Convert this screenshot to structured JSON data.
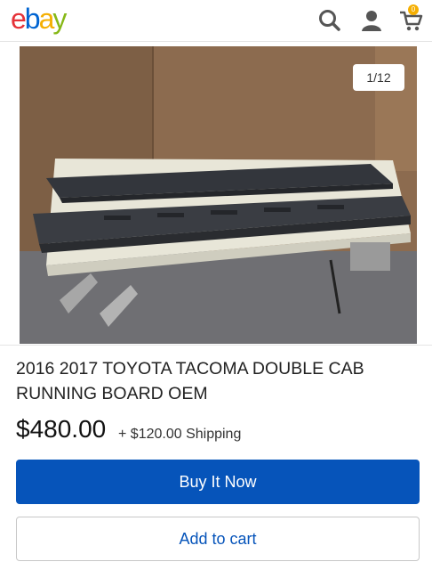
{
  "header": {
    "logo_letters": [
      {
        "char": "e",
        "color": "#e53238"
      },
      {
        "char": "b",
        "color": "#0064d2"
      },
      {
        "char": "a",
        "color": "#f5af02"
      },
      {
        "char": "y",
        "color": "#86b817"
      }
    ],
    "cart_count": "0",
    "icons": [
      "search-icon",
      "user-icon",
      "cart-icon"
    ]
  },
  "gallery": {
    "counter": "1/12"
  },
  "listing": {
    "title": "2016 2017 TOYOTA TACOMA DOUBLE CAB RUNNING BOARD OEM",
    "price": "$480.00",
    "shipping": "+ $120.00 Shipping"
  },
  "actions": {
    "buy_now_label": "Buy It Now",
    "add_to_cart_label": "Add to cart"
  },
  "colors": {
    "primary_blue": "#0654ba",
    "badge": "#f5af02"
  }
}
